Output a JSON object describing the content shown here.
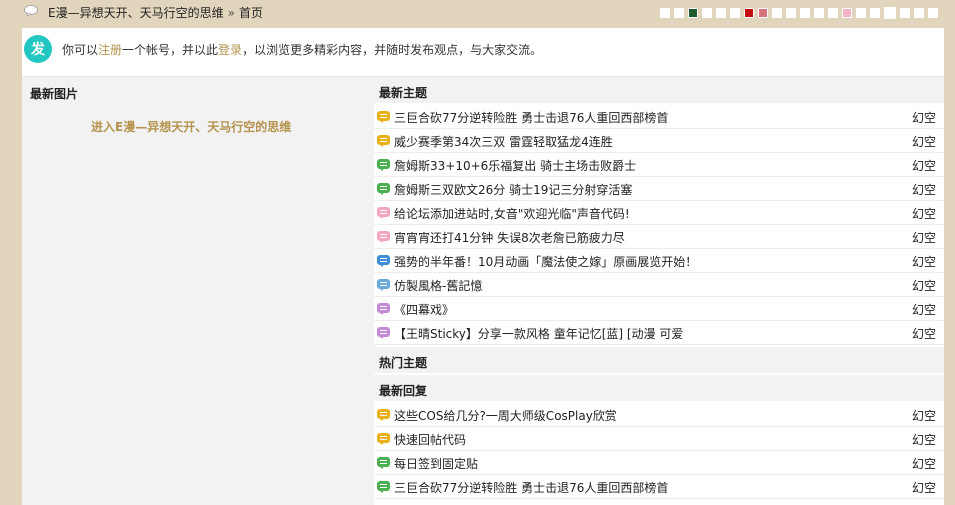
{
  "header": {
    "breadcrumb_site": "E漫—异想天开、天马行空的思维",
    "breadcrumb_sep": "»",
    "breadcrumb_current": "首页",
    "swatch_colors": [
      "#ffffff",
      "#ffffff",
      "#1f5a2f",
      "#ffffff",
      "#ffffff",
      "#ffffff",
      "#c30d0d",
      "#d9737d",
      "#ffffff",
      "#ffffff",
      "#ffffff",
      "#ffffff",
      "#ffffff",
      "#f2b3c5",
      "#ffffff",
      "#ffffff",
      "#ffffff",
      "#ffffff",
      "#ffffff",
      "#ffffff"
    ]
  },
  "notice": {
    "badge": "发",
    "prefix": "你可以",
    "register_link": "注册",
    "mid": "一个帐号，并以此",
    "login_link": "登录",
    "suffix": "，以浏览更多精彩内容，并随时发布观点，与大家交流。"
  },
  "left": {
    "heading": "最新图片",
    "enter_link": "进入E漫—异想天开、天马行空的思维"
  },
  "sections": {
    "latest_topics": {
      "heading": "最新主题",
      "rows": [
        {
          "title": "三巨合砍77分逆转险胜 勇士击退76人重回西部榜首",
          "author": "幻空",
          "icon_color": "#e8b019"
        },
        {
          "title": "威少赛季第34次三双 雷霆轻取猛龙4连胜",
          "author": "幻空",
          "icon_color": "#e8b019"
        },
        {
          "title": "詹姆斯33+10+6乐福复出 骑士主场击败爵士",
          "author": "幻空",
          "icon_color": "#4caf50"
        },
        {
          "title": "詹姆斯三双欧文26分 骑士19记三分射穿活塞",
          "author": "幻空",
          "icon_color": "#4caf50"
        },
        {
          "title": "给论坛添加进站时,女音\"欢迎光临\"声音代码!",
          "author": "幻空",
          "icon_color": "#f4a6c0"
        },
        {
          "title": "宵宵宵还打41分钟 失误8次老詹已筋疲力尽",
          "author": "幻空",
          "icon_color": "#f4a6c0"
        },
        {
          "title": "强势的半年番！10月动画「魔法使之嫁」原画展览开始！",
          "author": "幻空",
          "icon_color": "#3f8fd6"
        },
        {
          "title": "仿製風格-舊記憶",
          "author": "幻空",
          "icon_color": "#6aa9d9"
        },
        {
          "title": "《四幕戏》",
          "author": "幻空",
          "icon_color": "#c58ad6"
        },
        {
          "title": "【王晴Sticky】分享一款风格 童年记忆[蓝] [动漫 可爱",
          "author": "幻空",
          "icon_color": "#c58ad6"
        }
      ]
    },
    "hot_topics": {
      "heading": "热门主题"
    },
    "latest_replies": {
      "heading": "最新回复",
      "rows": [
        {
          "title": "这些COS给几分?一周大师级CosPlay欣赏",
          "author": "幻空",
          "icon_color": "#e8b019"
        },
        {
          "title": "快速回帖代码",
          "author": "幻空",
          "icon_color": "#e8b019"
        },
        {
          "title": "每日签到固定贴",
          "author": "幻空",
          "icon_color": "#4caf50"
        },
        {
          "title": "三巨合砍77分逆转险胜 勇士击退76人重回西部榜首",
          "author": "幻空",
          "icon_color": "#4caf50"
        }
      ]
    }
  }
}
